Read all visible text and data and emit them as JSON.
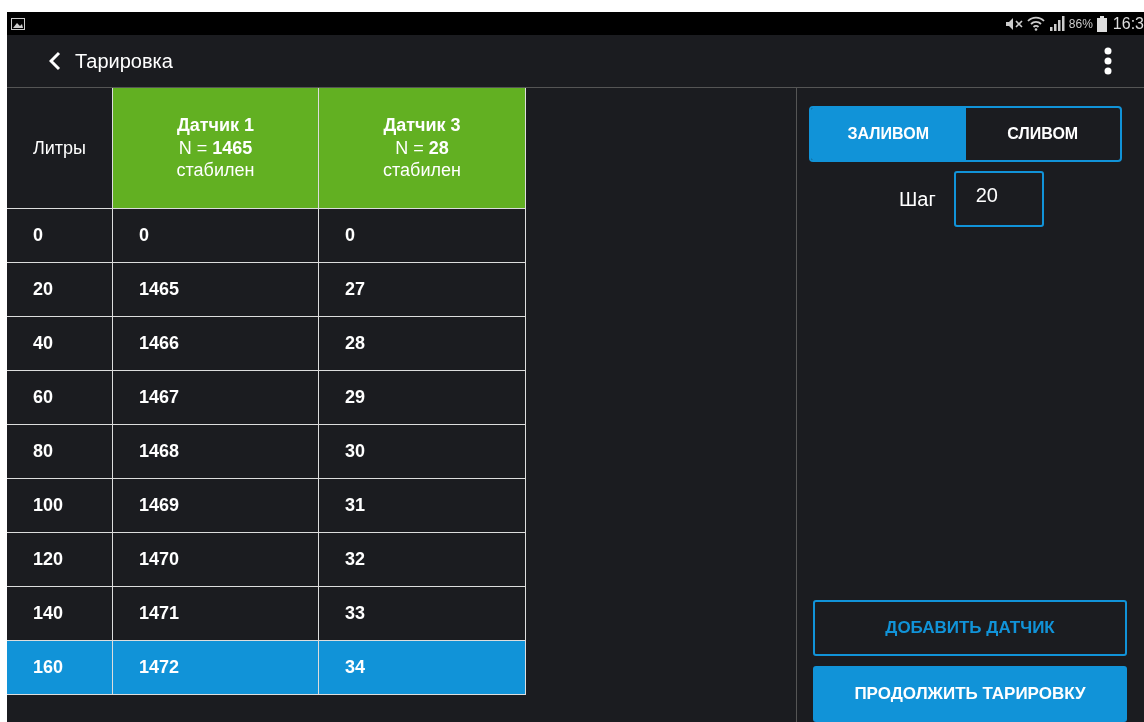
{
  "status_bar": {
    "battery": "86%",
    "time": "16:3"
  },
  "app_bar": {
    "title": "Тарировка"
  },
  "table": {
    "columns": [
      {
        "kind": "plain",
        "label": "Литры"
      },
      {
        "kind": "sensor",
        "name": "Датчик 1",
        "reading": "N = **1465**",
        "state": "стабилен"
      },
      {
        "kind": "sensor",
        "name": "Датчик 3",
        "reading": "N = **28**",
        "state": "стабилен"
      }
    ],
    "rows": [
      {
        "cells": [
          "0",
          "0",
          "0"
        ],
        "selected": false
      },
      {
        "cells": [
          "20",
          "1465",
          "27"
        ],
        "selected": false
      },
      {
        "cells": [
          "40",
          "1466",
          "28"
        ],
        "selected": false
      },
      {
        "cells": [
          "60",
          "1467",
          "29"
        ],
        "selected": false
      },
      {
        "cells": [
          "80",
          "1468",
          "30"
        ],
        "selected": false
      },
      {
        "cells": [
          "100",
          "1469",
          "31"
        ],
        "selected": false
      },
      {
        "cells": [
          "120",
          "1470",
          "32"
        ],
        "selected": false
      },
      {
        "cells": [
          "140",
          "1471",
          "33"
        ],
        "selected": false
      },
      {
        "cells": [
          "160",
          "1472",
          "34"
        ],
        "selected": true
      }
    ]
  },
  "mode_toggle": [
    {
      "label": "ЗАЛИВОМ",
      "selected": true
    },
    {
      "label": "СЛИВОМ",
      "selected": false
    }
  ],
  "step": {
    "label": "Шаг",
    "value": "20"
  },
  "buttons": [
    {
      "label": "ДОБАВИТЬ ДАТЧИК",
      "kind": "outline"
    },
    {
      "label": "ПРОДОЛЖИТЬ ТАРИРОВКУ",
      "kind": "filled"
    }
  ]
}
